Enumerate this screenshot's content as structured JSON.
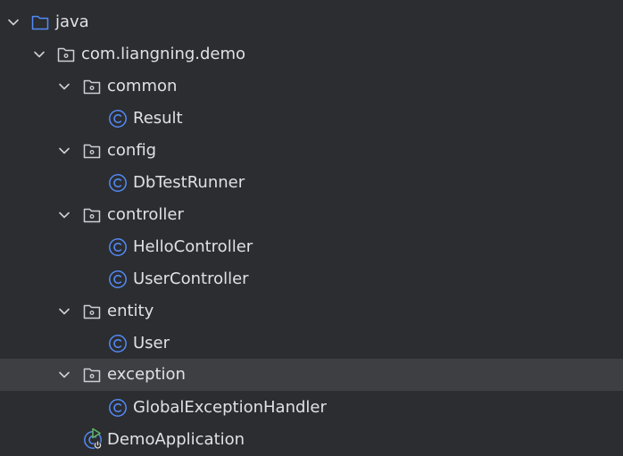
{
  "project_tree": {
    "root": {
      "label": "java",
      "icon": "source-folder-icon",
      "expanded": true
    },
    "package": {
      "label": "com.liangning.demo",
      "icon": "package-icon",
      "expanded": true
    },
    "common": {
      "label": "common",
      "expanded": true,
      "classes": [
        "Result"
      ]
    },
    "config": {
      "label": "config",
      "expanded": true,
      "classes": [
        "DbTestRunner"
      ]
    },
    "controller": {
      "label": "controller",
      "expanded": true,
      "classes": [
        "HelloController",
        "UserController"
      ]
    },
    "entity": {
      "label": "entity",
      "expanded": true,
      "classes": [
        "User"
      ]
    },
    "exception": {
      "label": "exception",
      "expanded": true,
      "selected": true,
      "classes": [
        "GlobalExceptionHandler"
      ]
    },
    "main_class": {
      "label": "DemoApplication",
      "icon": "spring-boot-run-class-icon"
    }
  },
  "colors": {
    "background": "#2b2d30",
    "selection": "#3d3f43",
    "text": "#dfe1e5",
    "class_icon": "#548af7",
    "folder_icon": "#548af7",
    "package_icon": "#ced0d6",
    "run_icon": "#5fb865"
  }
}
